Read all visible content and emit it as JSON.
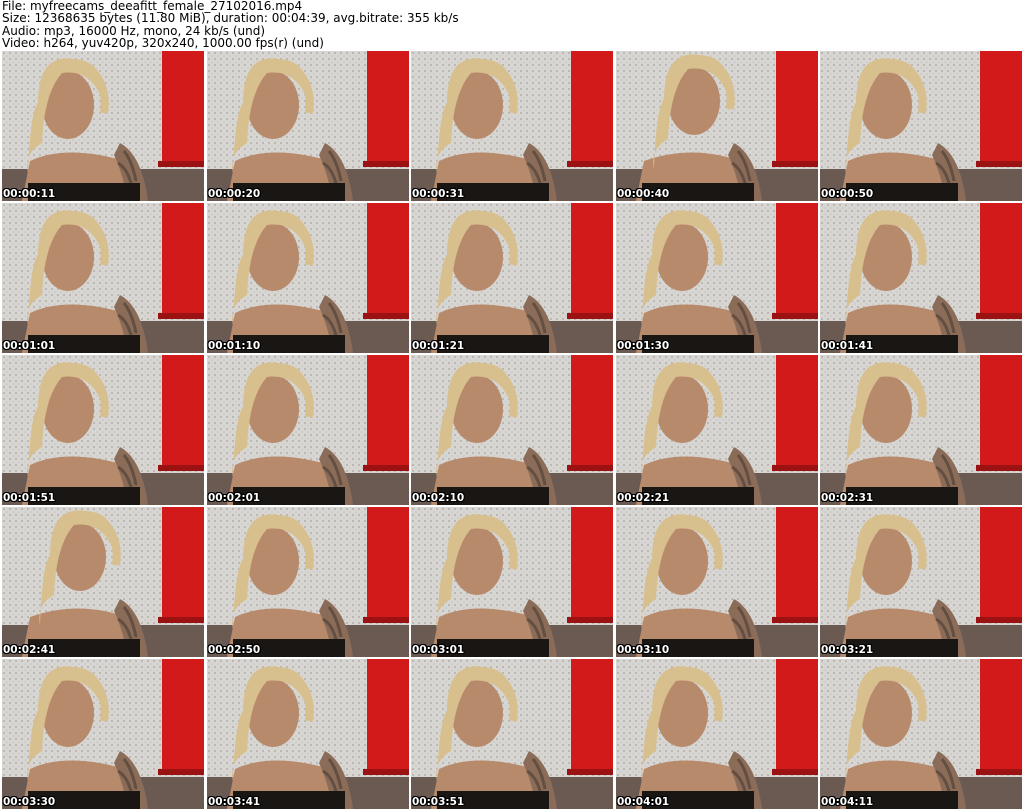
{
  "header": {
    "file_line": "File: myfreecams_deeafitt_female_27102016.mp4",
    "size_line": "Size: 12368635 bytes (11.80 MiB), duration: 00:04:39, avg.bitrate: 355 kb/s",
    "audio_line": "Audio: mp3, 16000 Hz, mono, 24 kb/s (und)",
    "video_line": "Video: h264, yuv420p, 320x240, 1000.00 fps(r) (und)"
  },
  "colors": {
    "wall": "#d8d6d3",
    "red_panel": "#d21a1a",
    "hair": "#d8bf8e",
    "skin": "#b88a6c",
    "top": "#1a1614",
    "couch": "#6a5a52"
  },
  "thumbnails": [
    {
      "timestamp": "00:00:11",
      "pose": "down"
    },
    {
      "timestamp": "00:00:20",
      "pose": "down"
    },
    {
      "timestamp": "00:00:31",
      "pose": "down"
    },
    {
      "timestamp": "00:00:40",
      "pose": "up"
    },
    {
      "timestamp": "00:00:50",
      "pose": "down"
    },
    {
      "timestamp": "00:01:01",
      "pose": "down"
    },
    {
      "timestamp": "00:01:10",
      "pose": "down"
    },
    {
      "timestamp": "00:01:21",
      "pose": "down"
    },
    {
      "timestamp": "00:01:30",
      "pose": "down"
    },
    {
      "timestamp": "00:01:41",
      "pose": "down"
    },
    {
      "timestamp": "00:01:51",
      "pose": "down"
    },
    {
      "timestamp": "00:02:01",
      "pose": "down"
    },
    {
      "timestamp": "00:02:10",
      "pose": "down"
    },
    {
      "timestamp": "00:02:21",
      "pose": "down"
    },
    {
      "timestamp": "00:02:31",
      "pose": "down"
    },
    {
      "timestamp": "00:02:41",
      "pose": "up"
    },
    {
      "timestamp": "00:02:50",
      "pose": "down"
    },
    {
      "timestamp": "00:03:01",
      "pose": "down"
    },
    {
      "timestamp": "00:03:10",
      "pose": "down"
    },
    {
      "timestamp": "00:03:21",
      "pose": "down"
    },
    {
      "timestamp": "00:03:30",
      "pose": "down"
    },
    {
      "timestamp": "00:03:41",
      "pose": "down"
    },
    {
      "timestamp": "00:03:51",
      "pose": "down"
    },
    {
      "timestamp": "00:04:01",
      "pose": "down"
    },
    {
      "timestamp": "00:04:11",
      "pose": "down"
    }
  ]
}
